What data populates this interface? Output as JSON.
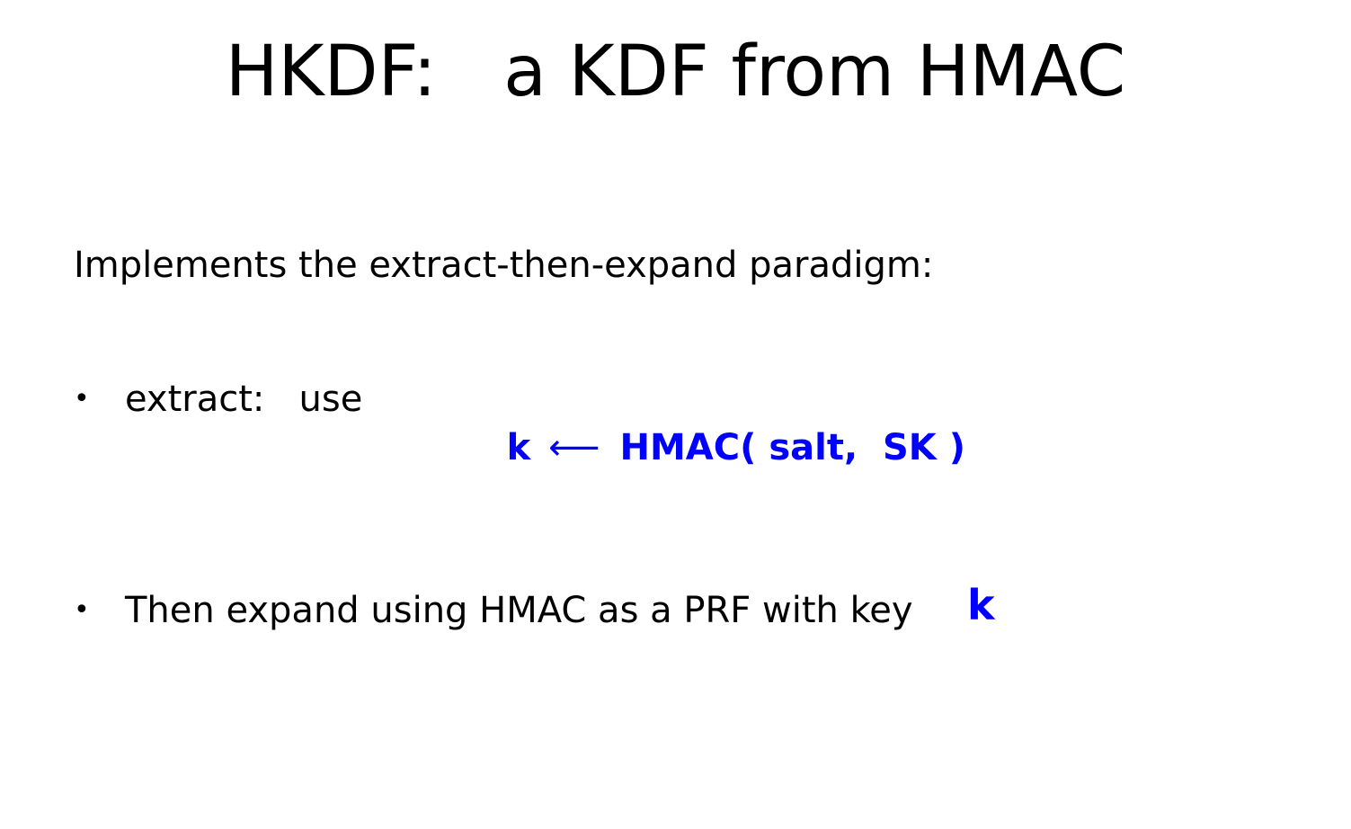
{
  "slide": {
    "title": "HKDF:   a KDF from HMAC",
    "intro": "Implements the extract-then-expand paradigm:",
    "bullets": [
      {
        "marker": "•",
        "text": "extract:   use",
        "formula": {
          "k": "k",
          "arrow": "⟵",
          "rest": "HMAC( salt,  SK )"
        }
      },
      {
        "marker": "•",
        "text": "Then expand using HMAC as a PRF with key",
        "key": "k"
      }
    ]
  },
  "colors": {
    "accent": "#0000FF",
    "text": "#000000",
    "background": "#FFFFFF"
  }
}
